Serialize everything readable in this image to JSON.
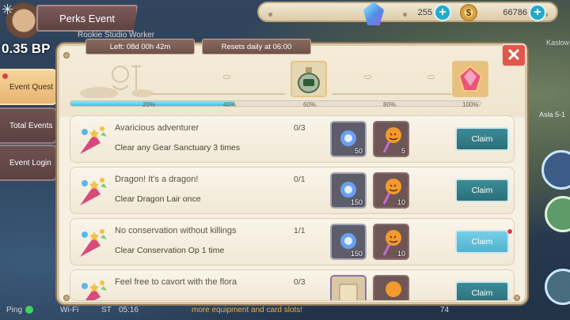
{
  "header": {
    "title": "Perks Event",
    "bp_label": "0.35 BP",
    "subtitle": "Rookie Studio Worker"
  },
  "currency": {
    "gems": "255",
    "coins": "66786"
  },
  "side_labels": {
    "kaslow": "Kaslow",
    "asla": "Asla 5-1"
  },
  "timers": {
    "left": "Left: 08d 00h 42m",
    "resets": "Resets daily at 06:00"
  },
  "tabs": [
    {
      "label": "Event Quest",
      "active": true
    },
    {
      "label": "Total Events",
      "active": false
    },
    {
      "label": "Event Login",
      "active": false
    }
  ],
  "progress": {
    "fraction": 0.4,
    "labels": [
      "20%",
      "40%",
      "60%",
      "80%",
      "100%"
    ]
  },
  "quests": [
    {
      "title": "Avaricious adventurer",
      "desc": "Clear any Gear Sanctuary 3 times",
      "progress": "0/3",
      "rewards": [
        "50",
        "5"
      ],
      "claim": "Claim",
      "ready": false
    },
    {
      "title": "Dragon! It's a dragon!",
      "desc": "Clear Dragon Lair once",
      "progress": "0/1",
      "rewards": [
        "150",
        "10"
      ],
      "claim": "Claim",
      "ready": false
    },
    {
      "title": "No conservation without killings",
      "desc": "Clear Conservation Op 1 time",
      "progress": "1/1",
      "rewards": [
        "150",
        "10"
      ],
      "claim": "Claim",
      "ready": true
    },
    {
      "title": "Feel free to cavort with the flora",
      "desc": "",
      "progress": "0/3",
      "rewards": [
        "",
        ""
      ],
      "claim": "Claim",
      "ready": false
    }
  ],
  "status": {
    "ping": "Ping",
    "wifi": "Wi-Fi",
    "st": "ST",
    "time": "05:16",
    "marquee": "more equipment and card slots!",
    "right_num": "74"
  },
  "colors": {
    "panel_bg": "#f6f0e2",
    "claim_button": "#2c6f7a",
    "claim_ready": "#4fb2d0",
    "progress_fill": "#3fc0e0",
    "close_button": "#e0584a"
  }
}
